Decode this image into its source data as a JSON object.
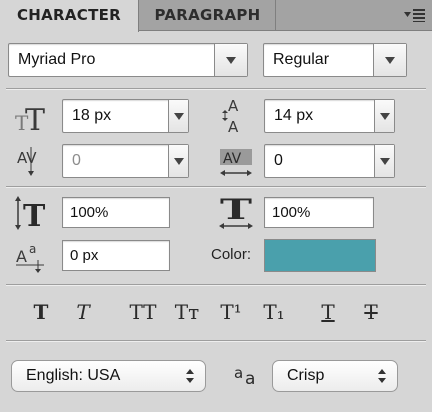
{
  "tabs": [
    {
      "label": "CHARACTER",
      "active": true
    },
    {
      "label": "PARAGRAPH",
      "active": false
    }
  ],
  "font": {
    "family": "Myriad Pro",
    "style": "Regular"
  },
  "size": {
    "value": "18 px",
    "icon": "font-size-icon"
  },
  "leading": {
    "value": "14 px",
    "icon": "leading-icon"
  },
  "kerning": {
    "value": "0",
    "disabled": true,
    "icon": "kerning-icon"
  },
  "tracking": {
    "value": "0",
    "icon": "tracking-icon"
  },
  "vertical_scale": {
    "value": "100%",
    "icon": "vertical-scale-icon"
  },
  "horizontal_scale": {
    "value": "100%",
    "icon": "horizontal-scale-icon"
  },
  "baseline_shift": {
    "value": "0 px",
    "icon": "baseline-shift-icon"
  },
  "color": {
    "label": "Color:",
    "value": "#4aa0ac"
  },
  "style_buttons": [
    {
      "name": "faux-bold",
      "glyph": "T"
    },
    {
      "name": "faux-italic",
      "glyph": "T"
    },
    {
      "name": "all-caps",
      "glyph": "TT"
    },
    {
      "name": "small-caps",
      "glyph": "Tт"
    },
    {
      "name": "superscript",
      "glyph": "T¹"
    },
    {
      "name": "subscript",
      "glyph": "T₁"
    },
    {
      "name": "underline",
      "glyph": "T"
    },
    {
      "name": "strikethrough",
      "glyph": "T"
    }
  ],
  "language": {
    "value": "English: USA"
  },
  "antialias": {
    "value": "Crisp",
    "icon": "antialias-icon"
  }
}
